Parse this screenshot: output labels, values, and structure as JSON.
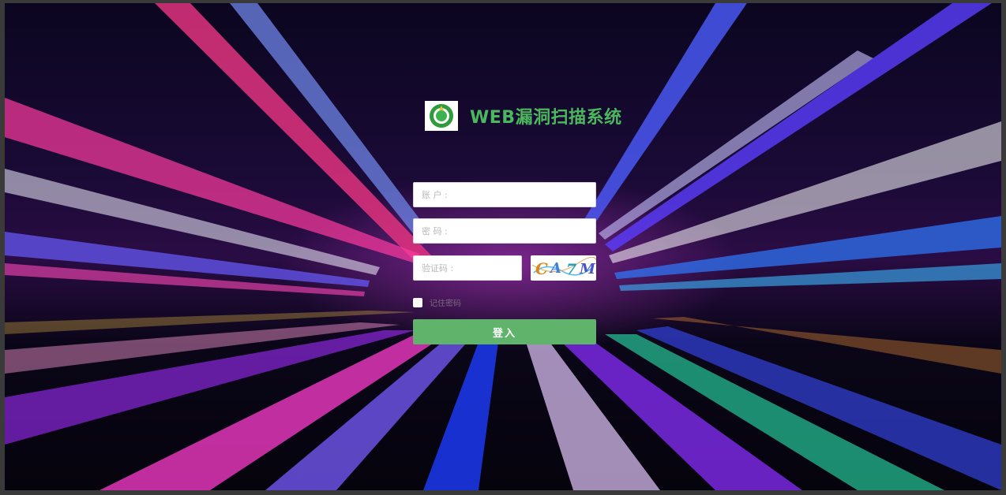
{
  "app": {
    "title": "WEB漏洞扫描系统",
    "logo_icon": "green-emblem-icon"
  },
  "form": {
    "account_placeholder": "账 户 :",
    "password_placeholder": "密 码 :",
    "captcha_placeholder": "验证码 :",
    "captcha_text": "CA7M",
    "remember_label": "记住密码",
    "remember_checked": false,
    "submit_label": "登入"
  },
  "colors": {
    "accent": "#5fb36a",
    "title": "#4cb85e"
  }
}
